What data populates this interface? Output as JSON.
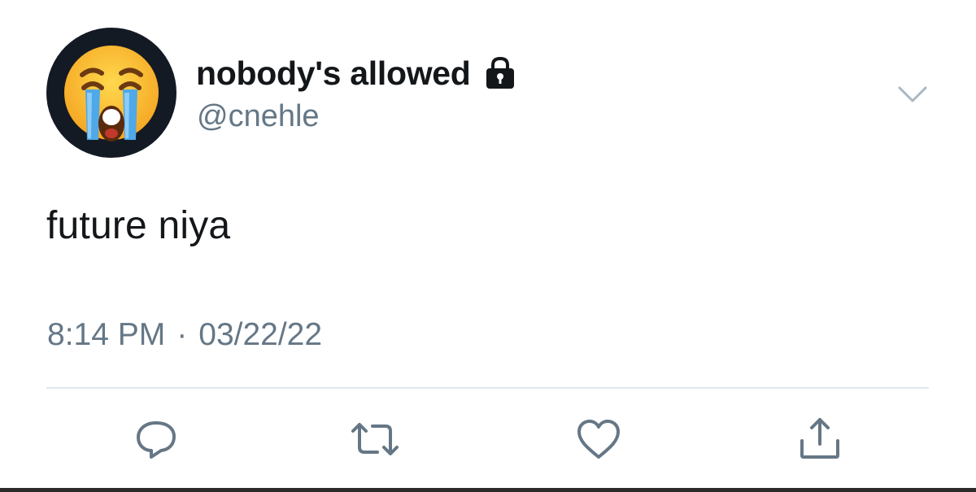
{
  "user": {
    "display_name": "nobody's allowed",
    "handle": "@cnehle",
    "avatar_icon": "loudly-crying-face-emoji",
    "protected_icon": "lock-icon"
  },
  "tweet": {
    "text": "future niya",
    "time": "8:14 PM",
    "separator": "·",
    "date": "03/22/22"
  },
  "actions": {
    "reply_icon": "reply-icon",
    "retweet_icon": "retweet-icon",
    "like_icon": "heart-icon",
    "share_icon": "share-icon",
    "menu_icon": "chevron-down-icon"
  },
  "colors": {
    "text_primary": "#14171a",
    "text_secondary": "#657786",
    "divider": "#e1e8ed",
    "icon": "#657786"
  }
}
